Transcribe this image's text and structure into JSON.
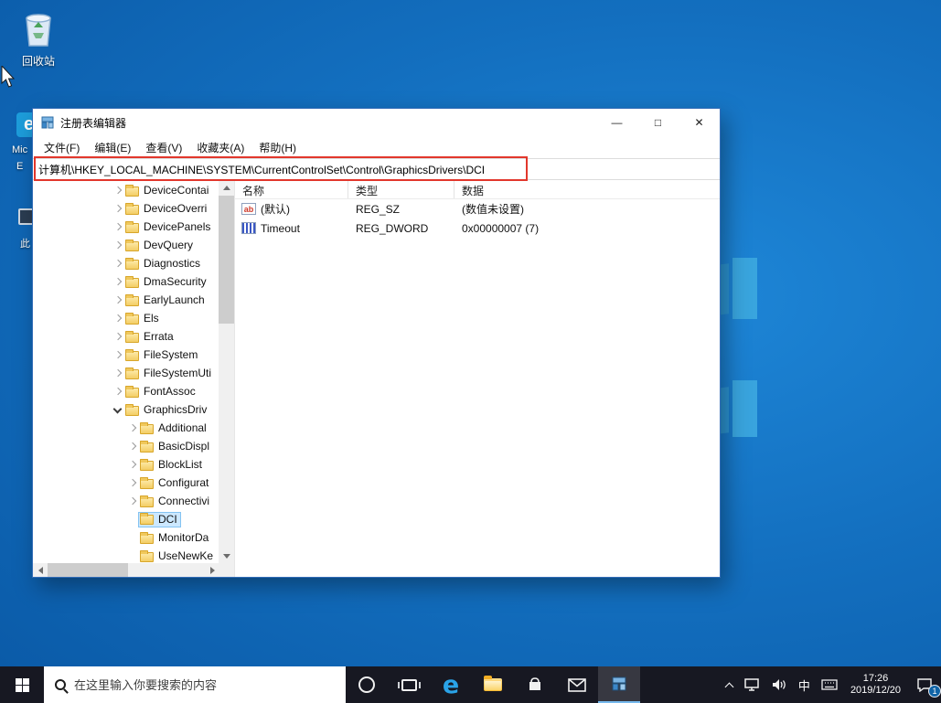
{
  "desktop": {
    "recycle_bin": "回收站",
    "edge_icon_line1": "Mic",
    "edge_icon_line2": "E",
    "this_pc": "此"
  },
  "regedit": {
    "title": "注册表编辑器",
    "controls": {
      "minimize": "—",
      "maximize": "□",
      "close": "✕"
    },
    "menu": [
      "文件(F)",
      "编辑(E)",
      "查看(V)",
      "收藏夹(A)",
      "帮助(H)"
    ],
    "address": "计算机\\HKEY_LOCAL_MACHINE\\SYSTEM\\CurrentControlSet\\Control\\GraphicsDrivers\\DCI",
    "tree": {
      "items": [
        {
          "label": "DeviceContai",
          "state": "collapsed",
          "level": 0
        },
        {
          "label": "DeviceOverri",
          "state": "collapsed",
          "level": 0
        },
        {
          "label": "DevicePanels",
          "state": "collapsed",
          "level": 0
        },
        {
          "label": "DevQuery",
          "state": "collapsed",
          "level": 0
        },
        {
          "label": "Diagnostics",
          "state": "collapsed",
          "level": 0
        },
        {
          "label": "DmaSecurity",
          "state": "collapsed",
          "level": 0
        },
        {
          "label": "EarlyLaunch",
          "state": "collapsed",
          "level": 0
        },
        {
          "label": "Els",
          "state": "collapsed",
          "level": 0
        },
        {
          "label": "Errata",
          "state": "collapsed",
          "level": 0
        },
        {
          "label": "FileSystem",
          "state": "collapsed",
          "level": 0
        },
        {
          "label": "FileSystemUti",
          "state": "collapsed",
          "level": 0
        },
        {
          "label": "FontAssoc",
          "state": "collapsed",
          "level": 0
        },
        {
          "label": "GraphicsDriv",
          "state": "expanded",
          "level": 0
        },
        {
          "label": "Additional",
          "state": "collapsed",
          "level": 1
        },
        {
          "label": "BasicDispl",
          "state": "collapsed",
          "level": 1
        },
        {
          "label": "BlockList",
          "state": "collapsed",
          "level": 1
        },
        {
          "label": "Configurat",
          "state": "collapsed",
          "level": 1
        },
        {
          "label": "Connectivi",
          "state": "collapsed",
          "level": 1
        },
        {
          "label": "DCI",
          "state": "leaf",
          "level": 1,
          "selected": true
        },
        {
          "label": "MonitorDa",
          "state": "leaf",
          "level": 1
        },
        {
          "label": "UseNewKe",
          "state": "leaf",
          "level": 1
        }
      ]
    },
    "list": {
      "columns": [
        "名称",
        "类型",
        "数据"
      ],
      "sz_icon_text": "ab",
      "rows": [
        {
          "name": "(默认)",
          "type": "REG_SZ",
          "data": "(数值未设置)"
        },
        {
          "name": "Timeout",
          "type": "REG_DWORD",
          "data": "0x00000007 (7)"
        }
      ]
    }
  },
  "taskbar": {
    "search_placeholder": "在这里输入你要搜索的内容",
    "ime": "中",
    "clock": {
      "time": "17:26",
      "date": "2019/12/20"
    },
    "notification_badge": "1"
  }
}
